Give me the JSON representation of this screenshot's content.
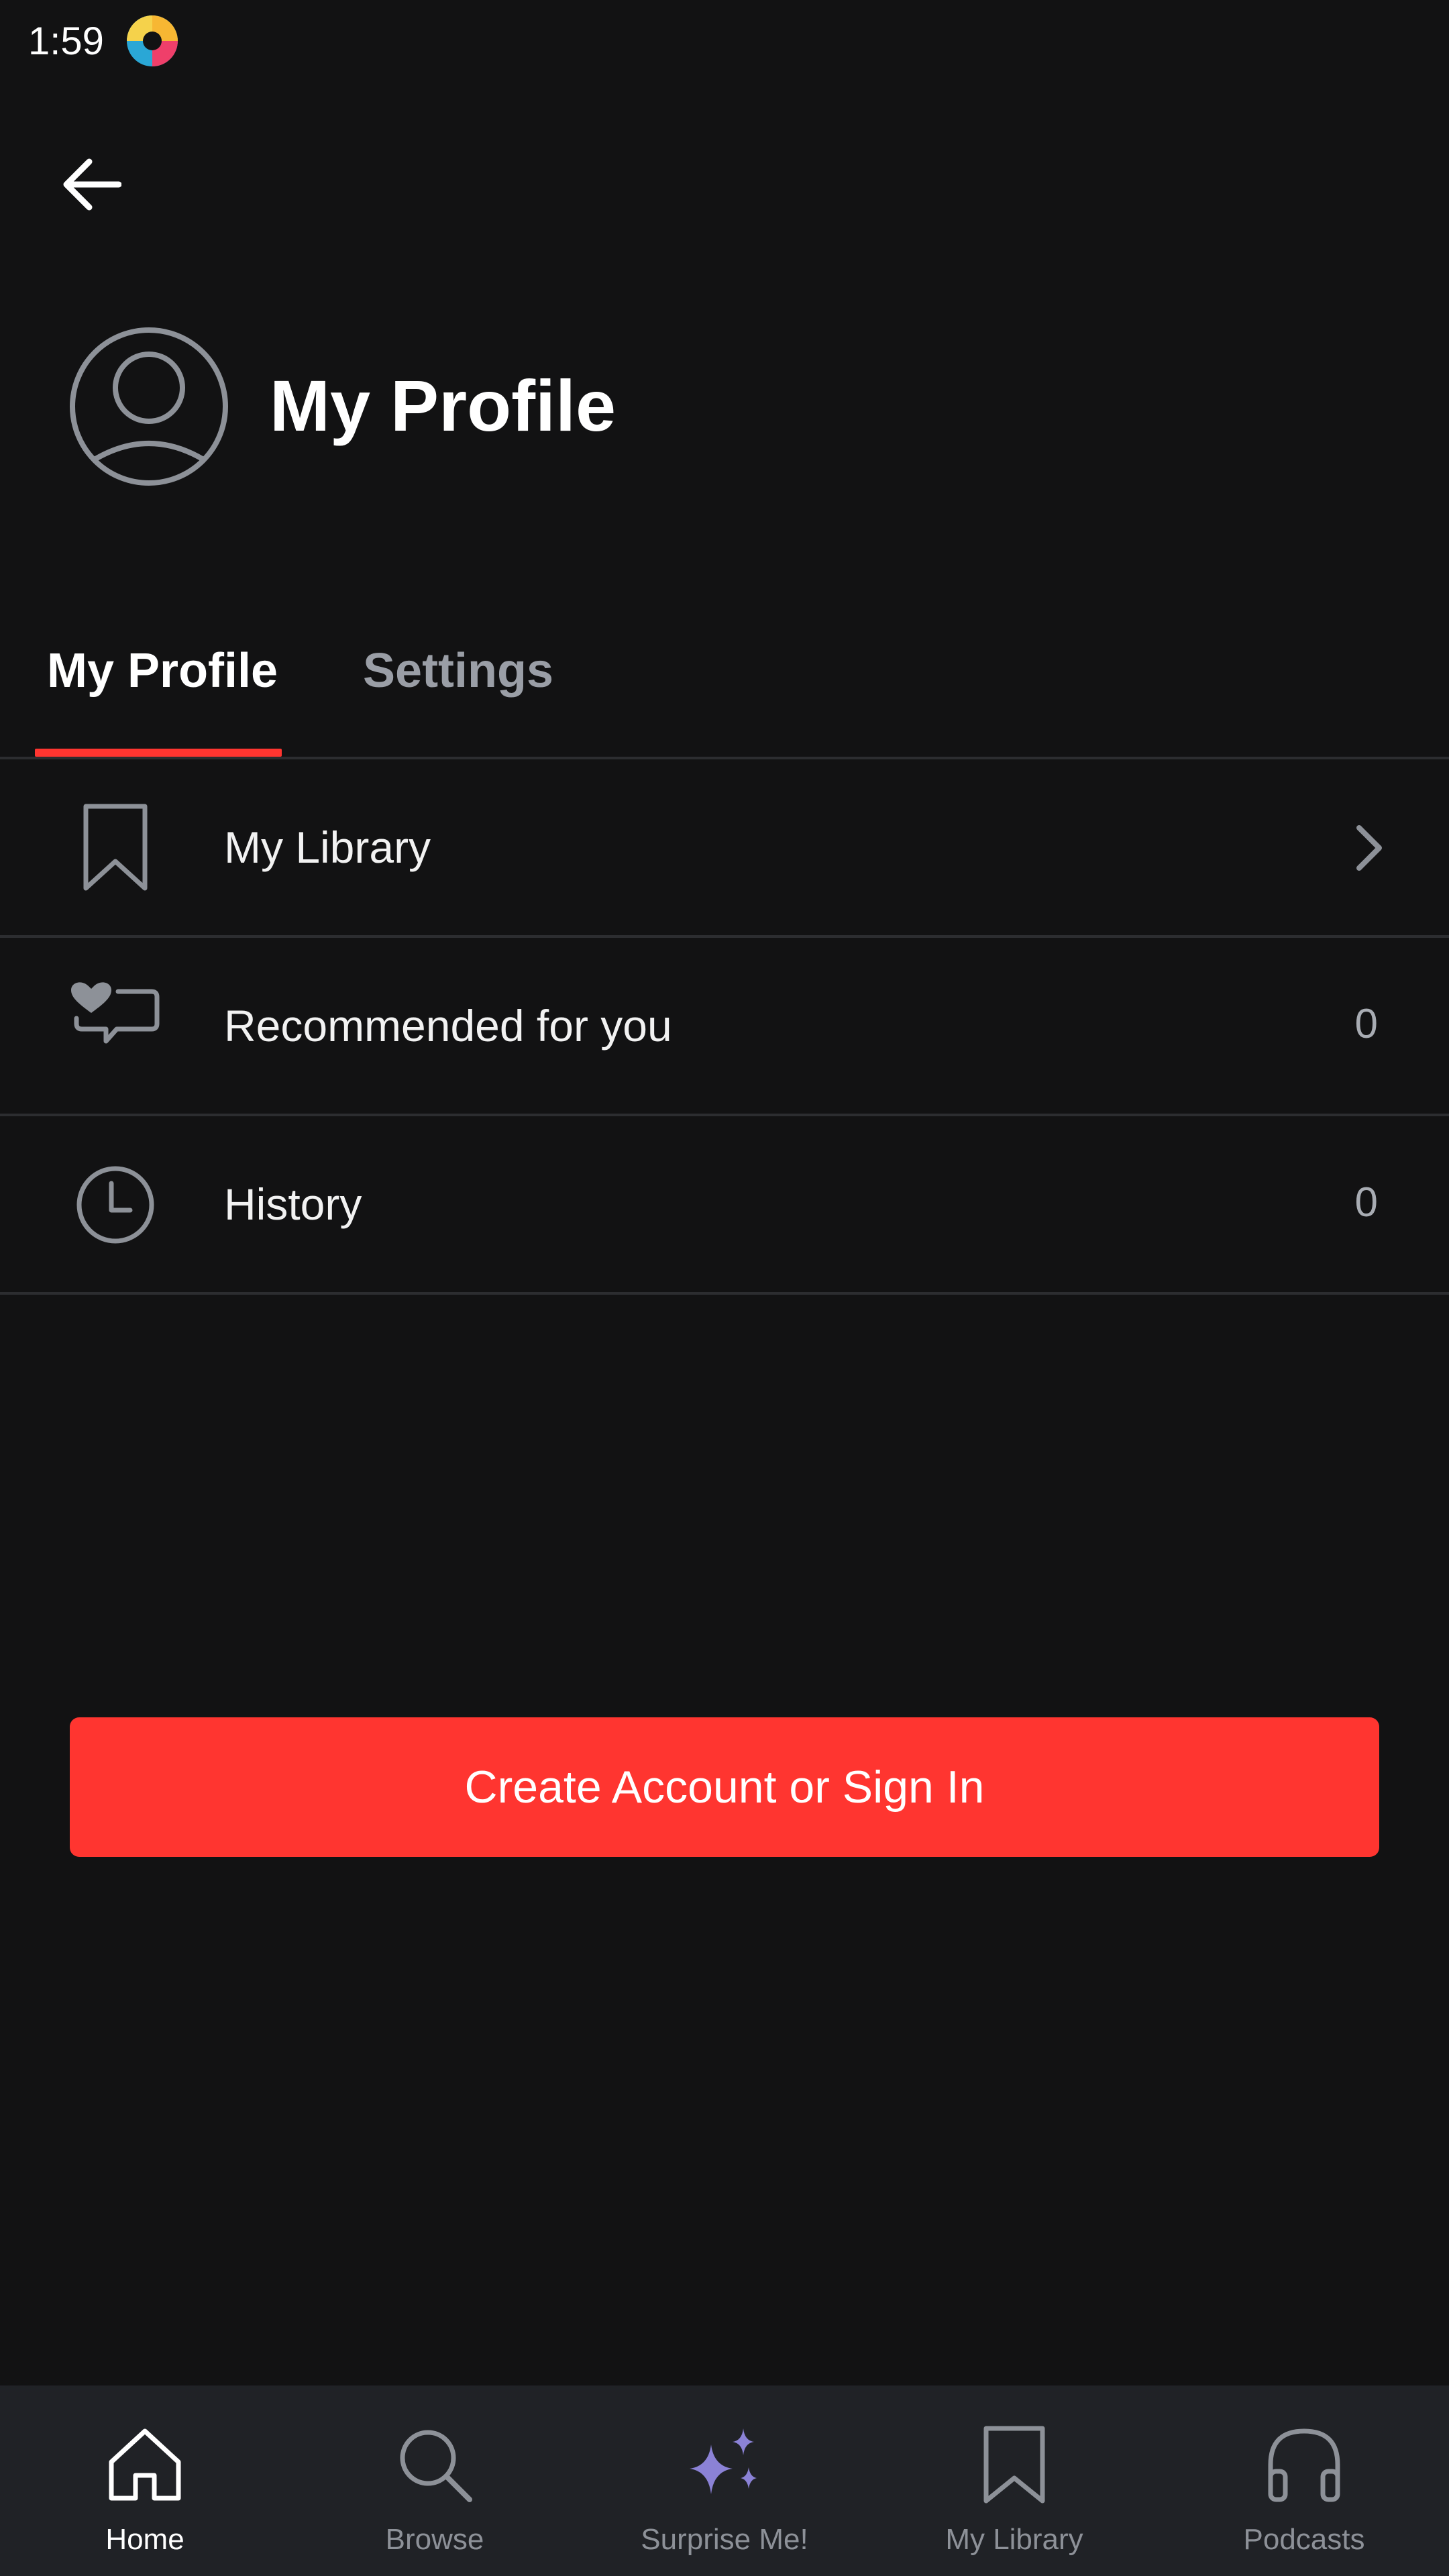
{
  "status_bar": {
    "time": "1:59",
    "app_icon": "colorful-app-icon"
  },
  "header": {
    "back_icon": "arrow-left-icon",
    "avatar_icon": "user-avatar-icon",
    "title": "My Profile"
  },
  "tabs": [
    {
      "label": "My Profile",
      "active": true
    },
    {
      "label": "Settings",
      "active": false
    }
  ],
  "list": [
    {
      "label": "My Library",
      "icon": "bookmark-icon",
      "trailing": "chevron-right-icon",
      "count": ""
    },
    {
      "label": "Recommended for you",
      "icon": "heart-chat-icon",
      "trailing": "",
      "count": "0"
    },
    {
      "label": "History",
      "icon": "clock-icon",
      "trailing": "",
      "count": "0"
    }
  ],
  "cta": {
    "label": "Create Account or Sign In"
  },
  "bottom_nav": [
    {
      "label": "Home",
      "icon": "home-icon",
      "active": true
    },
    {
      "label": "Browse",
      "icon": "search-icon",
      "active": false
    },
    {
      "label": "Surprise Me!",
      "icon": "sparkles-icon",
      "active": false
    },
    {
      "label": "My Library",
      "icon": "bookmark-icon",
      "active": false
    },
    {
      "label": "Podcasts",
      "icon": "headphones-icon",
      "active": false
    }
  ],
  "colors": {
    "background": "#121213",
    "accent": "#ff3530",
    "nav_background": "#202226",
    "sparkle": "#8b82d6"
  }
}
